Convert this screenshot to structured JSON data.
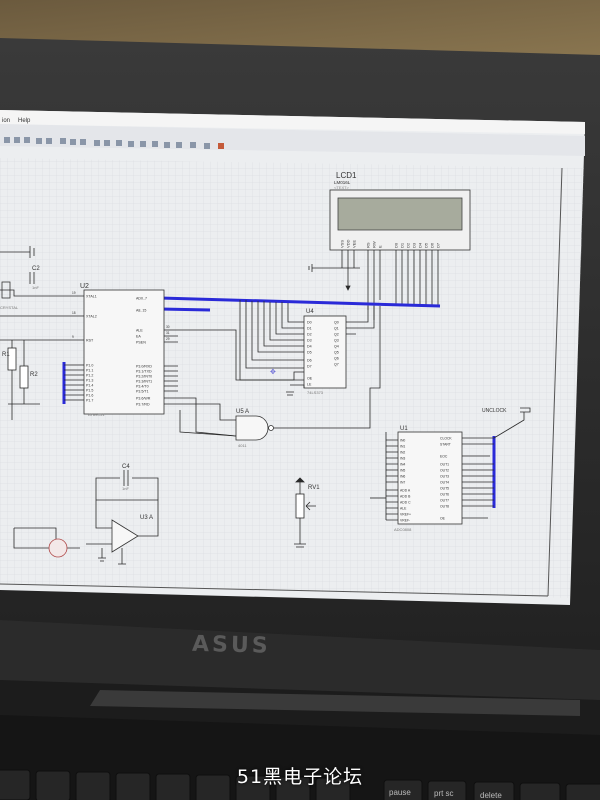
{
  "menu": {
    "partial_item": "ion",
    "help": "Help"
  },
  "lcd": {
    "ref": "LCD1",
    "part": "LM016L",
    "hint": "<TEXT>",
    "pins": [
      "VSS",
      "VDD",
      "VEE",
      "RS",
      "RW",
      "E",
      "D0",
      "D1",
      "D2",
      "D3",
      "D4",
      "D5",
      "D6",
      "D7"
    ]
  },
  "u2": {
    "ref": "U2",
    "part": "AT89C51",
    "pins_left": [
      "XTAL1",
      "XTAL2",
      "RST",
      "P1.0",
      "P1.1",
      "P1.2",
      "P1.3",
      "P1.4",
      "P1.5",
      "P1.6",
      "P1.7"
    ],
    "pins_right": [
      "AD0..7",
      "A8..15",
      "ALE",
      "EA",
      "PSEN",
      "P3.0/RXD",
      "P3.1/TXD",
      "P3.2/INT0",
      "P3.3/INT1",
      "P3.4/T0",
      "P3.5/T1",
      "P3.6/WR",
      "P3.7/RD"
    ],
    "pin_nums": [
      "19",
      "18",
      "9",
      "30",
      "31",
      "29"
    ]
  },
  "u4": {
    "ref": "U4",
    "part": "74LS373",
    "pins_in": [
      "D0",
      "D1",
      "D2",
      "D3",
      "D4",
      "D5",
      "D6",
      "D7",
      "OE",
      "LE"
    ],
    "pins_out": [
      "Q0",
      "Q1",
      "Q2",
      "Q3",
      "Q4",
      "Q5",
      "Q6",
      "Q7"
    ]
  },
  "u5": {
    "ref": "U5 A",
    "part": "4011"
  },
  "u1": {
    "ref": "U1",
    "part": "ADC0808",
    "pins_left": [
      "IN0",
      "IN1",
      "IN2",
      "IN3",
      "IN4",
      "IN5",
      "IN6",
      "IN7",
      "ADD A",
      "ADD B",
      "ADD C",
      "ALE",
      "VREF+",
      "VREF-"
    ],
    "pins_right": [
      "CLOCK",
      "START",
      "EOC",
      "OUT1",
      "OUT2",
      "OUT3",
      "OUT4",
      "OUT5",
      "OUT6",
      "OUT7",
      "OUT8",
      "OE"
    ]
  },
  "u3": {
    "ref": "U3 A"
  },
  "rv1": {
    "ref": "RV1"
  },
  "c4": {
    "ref": "C4",
    "value": "1nF"
  },
  "c2": {
    "ref": "C2",
    "value": "1nF"
  },
  "r1": {
    "ref": "R1"
  },
  "r2": {
    "ref": "R2"
  },
  "crystal": {
    "label": "CRYSTAL"
  },
  "clock": {
    "label": "UNCLOCK"
  },
  "laptop": {
    "brand": "ASUS"
  },
  "keys": [
    "pause",
    "prt sc",
    "delete"
  ],
  "watermark": "51黑电子论坛",
  "colors": {
    "bus": "#2a2ad8",
    "wire": "#2a2a2a",
    "screen": "#e9eaec",
    "lcd_glass": "#a7ab9d"
  }
}
